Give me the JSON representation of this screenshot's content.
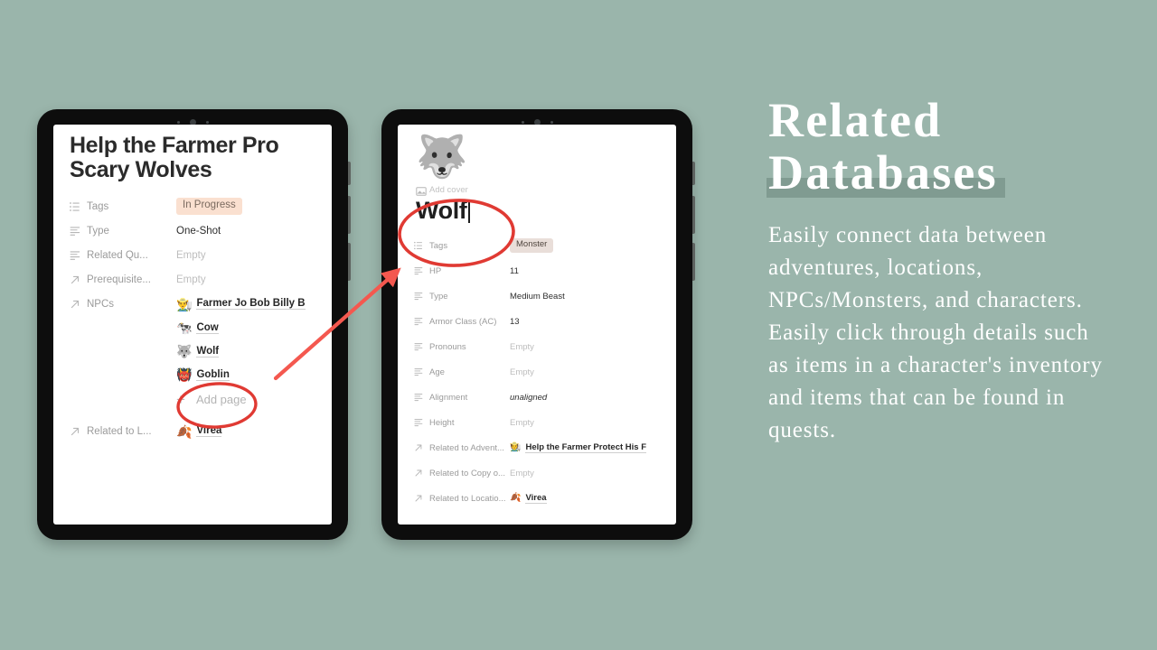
{
  "canvas": {
    "background_color": "#9ab5ab",
    "annotation_color": "#f4584f"
  },
  "left_tablet": {
    "name": "adventure-page-tablet",
    "page": {
      "title_line1": "Help the Farmer Pro",
      "title_line2": "Scary Wolves",
      "properties": [
        {
          "icon": "list-icon",
          "label": "Tags",
          "value": "In Progress",
          "kind": "tag-inprogress"
        },
        {
          "icon": "text-icon",
          "label": "Type",
          "value": "One-Shot",
          "kind": "text"
        },
        {
          "icon": "text-icon",
          "label": "Related Qu...",
          "value": "Empty",
          "kind": "empty"
        },
        {
          "icon": "arrow-icon",
          "label": "Prerequisite...",
          "value": "Empty",
          "kind": "empty"
        },
        {
          "icon": "arrow-icon",
          "label": "NPCs",
          "value": "Farmer Jo Bob Billy B",
          "kind": "link",
          "emoji": "👨‍🌾"
        }
      ],
      "npc_extra": [
        {
          "emoji": "🐄",
          "label": "Cow"
        },
        {
          "emoji": "🐺",
          "label": "Wolf"
        },
        {
          "emoji": "👹",
          "label": "Goblin"
        }
      ],
      "add_page_label": "Add page",
      "add_page_icon": "plus-icon",
      "footer_property": {
        "icon": "arrow-icon",
        "label": "Related to L...",
        "emoji": "🍂",
        "value": "Virea"
      }
    }
  },
  "right_tablet": {
    "name": "wolf-page-tablet",
    "page": {
      "page_emoji": "🐺",
      "add_cover_label": "Add cover",
      "add_cover_icon": "image-icon",
      "title": "Wolf",
      "properties": [
        {
          "icon": "list-icon",
          "label": "Tags",
          "value": "Monster",
          "kind": "tag-monster"
        },
        {
          "icon": "text-icon",
          "label": "HP",
          "value": "11",
          "kind": "text"
        },
        {
          "icon": "text-icon",
          "label": "Type",
          "value": "Medium Beast",
          "kind": "text"
        },
        {
          "icon": "text-icon",
          "label": "Armor Class (AC)",
          "value": "13",
          "kind": "text"
        },
        {
          "icon": "text-icon",
          "label": "Pronouns",
          "value": "Empty",
          "kind": "empty"
        },
        {
          "icon": "text-icon",
          "label": "Age",
          "value": "Empty",
          "kind": "empty"
        },
        {
          "icon": "text-icon",
          "label": "Alignment",
          "value": "unaligned",
          "kind": "italic"
        },
        {
          "icon": "text-icon",
          "label": "Height",
          "value": "Empty",
          "kind": "empty"
        },
        {
          "icon": "arrow-icon",
          "label": "Related to Advent...",
          "value": "Help the Farmer Protect His F",
          "kind": "link",
          "emoji": "🧑‍🌾"
        },
        {
          "icon": "arrow-icon",
          "label": "Related to Copy o...",
          "value": "Empty",
          "kind": "empty"
        },
        {
          "icon": "arrow-icon",
          "label": "Related to Locatio...",
          "value": "Virea",
          "kind": "link",
          "emoji": "🍂"
        }
      ]
    }
  },
  "annotations": {
    "ellipse_wolf_list": "ellipse-highlight-wolf-row",
    "ellipse_wolf_title": "ellipse-highlight-wolf-title",
    "arrow": "arrow-wolf-row-to-wolf-page"
  },
  "text_panel": {
    "headline_line1": "Related",
    "headline_line2": "Databases",
    "body": "Easily connect data between adventures, locations, NPCs/Monsters, and characters. Easily click through details such as items in a character's inventory and items that can be found in quests."
  }
}
